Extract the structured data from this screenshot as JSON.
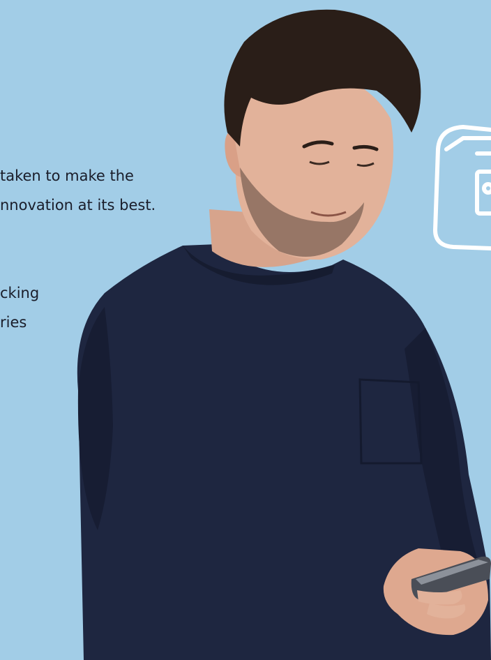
{
  "text_lines": [
    "taken to make the",
    "nnovation at its best.",
    "cking",
    "ries"
  ],
  "colors": {
    "background": "#a2cde7",
    "sweater": "#1e2640",
    "skin": "#e2b29a",
    "hair": "#2a1e18",
    "icon_stroke": "#ffffff",
    "phone": "#4a4e57"
  },
  "icons": [
    "camera-icon"
  ]
}
